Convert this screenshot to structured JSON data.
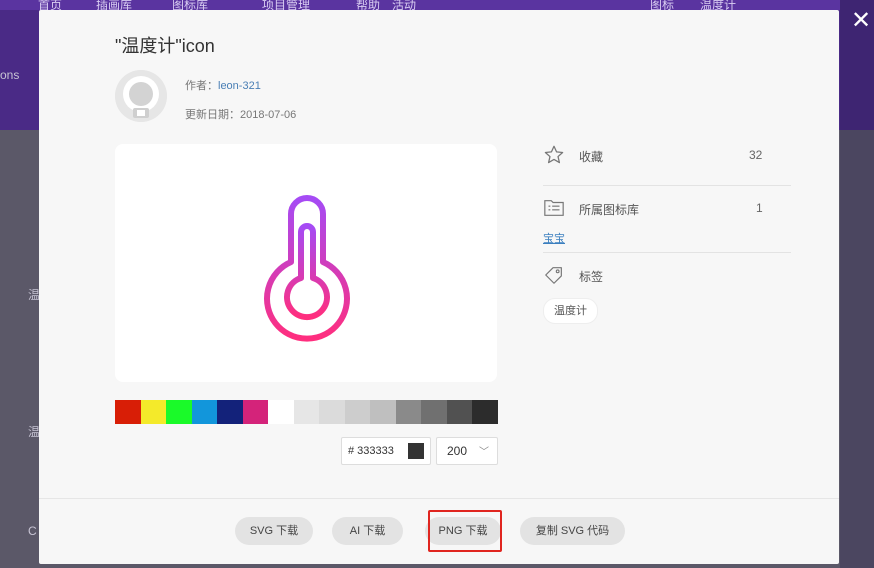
{
  "background": {
    "nav_items": [
      "首页",
      "插画库",
      "图标库",
      "项目管理",
      "帮助",
      "活动",
      "图标",
      "温度计"
    ],
    "side_texts": [
      "ons",
      "温",
      "温",
      "C"
    ]
  },
  "modal": {
    "title": "\"温度计\"icon",
    "author_label": "作者：",
    "author_value": "leon-321",
    "updated_label": "更新日期：",
    "updated_value": "2018-07-06",
    "palette": [
      "#d81e06",
      "#f4ea2a",
      "#1afa29",
      "#1296db",
      "#13227a",
      "#d4237a",
      "#ffffff",
      "#e6e6e6",
      "#dbdbdb",
      "#cdcdcd",
      "#bfbfbf",
      "#8a8a8a",
      "#707070",
      "#515151",
      "#2c2c2c"
    ],
    "hex_prefix": "#",
    "hex_value": "333333",
    "size_value": "200",
    "favorites_label": "收藏",
    "favorites_count": "32",
    "library_label": "所属图标库",
    "library_count": "1",
    "library_name": "宝宝",
    "tags_label": "标签",
    "tag": "温度计",
    "buttons": {
      "svg": "SVG 下载",
      "ai": "AI 下载",
      "png": "PNG 下载",
      "copy": "复制 SVG 代码"
    },
    "icon_gradient": [
      "#a54bf5",
      "#ff2e7e"
    ]
  }
}
